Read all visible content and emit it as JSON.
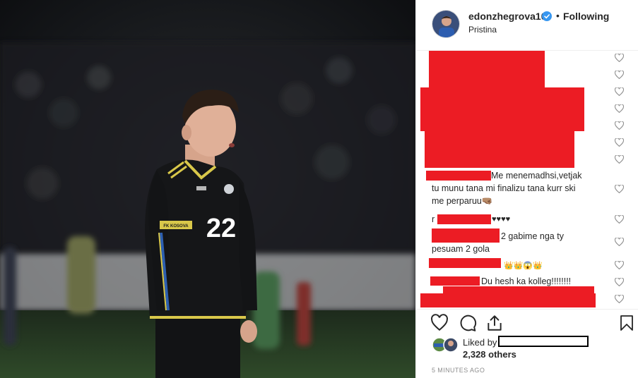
{
  "post": {
    "username": "edonzhegrova10",
    "separator": "•",
    "follow_status": "Following",
    "location": "Pristina",
    "timestamp": "5 MINUTES AGO"
  },
  "photo": {
    "jersey_number": "22",
    "sleeve_text": "FK KOSOVA"
  },
  "comments": [
    {
      "text": "Me menemadhsi,vetjak",
      "text2": "tu munu tana mi finalizu tana kurr ski",
      "text3": "me perparuu🤜🏽"
    },
    {
      "prefix": "r",
      "text": "♥♥♥♥"
    },
    {
      "text": "2 gabime nga ty",
      "text2": "pesuam 2 gola"
    },
    {
      "text": "👑👑😱👑"
    },
    {
      "text": "Du hesh ka kolleg!!!!!!!!"
    }
  ],
  "likes": {
    "liked_by_label": "Liked by",
    "others": "2,328 others"
  },
  "colors": {
    "redaction": "#ec1c24",
    "verified": "#3897f0",
    "text": "#262626",
    "muted": "#8e8e8e"
  },
  "icons": [
    "heart-icon",
    "comment-icon",
    "share-icon",
    "bookmark-icon",
    "verified-badge-icon"
  ]
}
